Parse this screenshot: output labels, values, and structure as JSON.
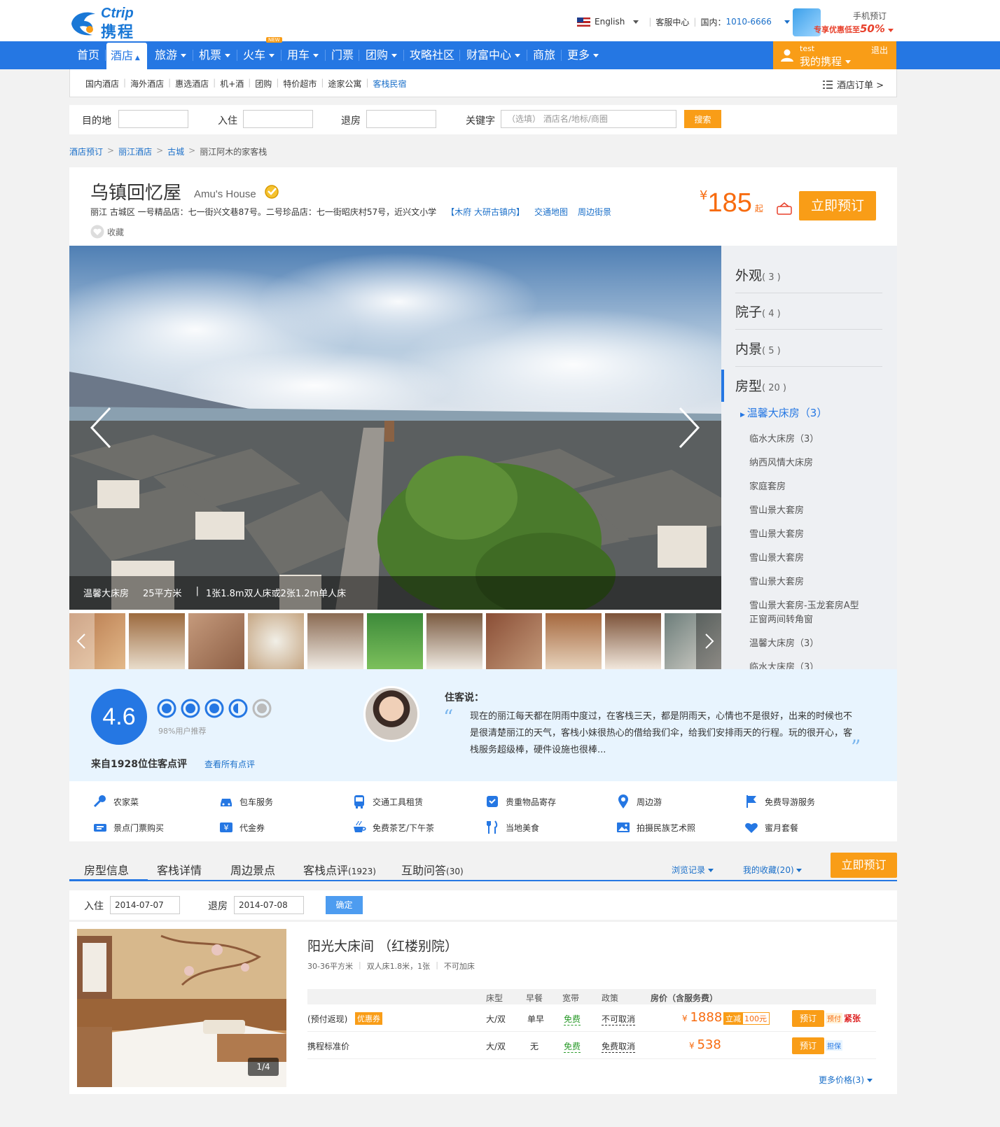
{
  "header": {
    "logo_en": "Ctrip",
    "logo_cn": "携程",
    "language": "English",
    "service": "客服中心",
    "phone_label": "国内：",
    "phone_number": "1010-6666",
    "mobile_title": "手机预订",
    "mobile_promo": "专享优惠低至",
    "mobile_promo_pct": "50%"
  },
  "nav": {
    "items": [
      {
        "label": "首页"
      },
      {
        "label": "酒店"
      },
      {
        "label": "旅游"
      },
      {
        "label": "机票"
      },
      {
        "label": "火车",
        "badge": "NEW"
      },
      {
        "label": "用车"
      },
      {
        "label": "门票"
      },
      {
        "label": "团购"
      },
      {
        "label": "攻略社区"
      },
      {
        "label": "财富中心"
      },
      {
        "label": "商旅"
      },
      {
        "label": "更多"
      }
    ],
    "user_name": "test",
    "user_menu": "我的携程",
    "logout": "退出"
  },
  "subnav": {
    "items": [
      "国内酒店",
      "海外酒店",
      "惠选酒店",
      "机+酒",
      "团购",
      "特价超市",
      "途家公寓",
      "客栈民宿"
    ],
    "orders": "酒店订单 >"
  },
  "search": {
    "destination_label": "目的地",
    "checkin_label": "入住",
    "checkout_label": "退房",
    "keyword_label": "关键字",
    "keyword_placeholder": "（选填） 酒店名/地标/商圈",
    "button": "搜索"
  },
  "breadcrumb": [
    "酒店预订",
    "丽江酒店",
    "古城",
    "丽江阿木的家客栈"
  ],
  "hotel": {
    "name_cn": "乌镇回忆屋",
    "name_en": "Amu's House",
    "address": "丽江 古城区 一号精品店：七一街兴文巷87号。二号珍品店：七一街昭庆村57号，近兴文小学",
    "area_tag": "【木府 大研古镇内】",
    "map_link": "交通地图",
    "street_link": "周边街景",
    "favorite": "收藏",
    "price_symbol": "¥",
    "price": "185",
    "price_suffix": "起",
    "book_button": "立即预订"
  },
  "gallery": {
    "caption_room": "温馨大床房",
    "caption_area": "25平方米",
    "caption_beds": "1张1.8m双人床或2张1.2m单人床",
    "categories": [
      {
        "name": "外观",
        "count": "( 3 )"
      },
      {
        "name": "院子",
        "count": "( 4 )"
      },
      {
        "name": "内景",
        "count": "( 5 )"
      },
      {
        "name": "房型",
        "count": "( 20 )"
      }
    ],
    "room_types": [
      "温馨大床房（3）",
      "临水大床房（3）",
      "纳西风情大床房",
      "家庭套房",
      "雪山景大套房",
      "雪山景大套房",
      "雪山景大套房",
      "雪山景大套房",
      "雪山景大套房-玉龙套房A型",
      "正窗两间转角窗",
      "温馨大床房（3）",
      "临水大床房（3）"
    ]
  },
  "rating": {
    "score": "4.6",
    "recommend": "98%用户推荐",
    "review_count_text": "来自1928位住客点评",
    "all_reviews": "查看所有点评",
    "guest_says": "住客说：",
    "review_text": "现在的丽江每天都在阴雨中度过，在客栈三天，都是阴雨天，心情也不是很好，出来的时候也不是很清楚丽江的天气，客栈小妹很热心的借给我们伞，给我们安排雨天的行程。玩的很开心，客栈服务超级棒，硬件设施也很棒..."
  },
  "amenities": [
    "农家菜",
    "包车服务",
    "交通工具租赁",
    "贵重物品寄存",
    "周边游",
    "免费导游服务",
    "景点门票购买",
    "代金券",
    "免费茶艺/下午茶",
    "当地美食",
    "拍摄民族艺术照",
    "蜜月套餐"
  ],
  "tabs": {
    "items": [
      "房型信息",
      "客栈详情",
      "周边景点",
      "客栈点评",
      "互助问答"
    ],
    "review_count": "(1923)",
    "qa_count": "(30)",
    "history": "浏览记录",
    "favorites": "我的收藏(20)",
    "book": "立即预订"
  },
  "dates": {
    "checkin_label": "入住",
    "checkin": "2014-07-07",
    "checkout_label": "退房",
    "checkout": "2014-07-08",
    "confirm": "确定"
  },
  "room": {
    "title": "阳光大床间 （红楼别院）",
    "specs": [
      "30-36平方米",
      "双人床1.8米，1张",
      "不可加床"
    ],
    "photo_counter": "1/4",
    "headers": [
      "床型",
      "早餐",
      "宽带",
      "政策",
      "房价（含服务费）"
    ],
    "rows": [
      {
        "name": "(预付返现)",
        "tag": "优惠券",
        "bed": "大/双",
        "breakfast": "单早",
        "wifi": "免费",
        "policy": "不可取消",
        "price_symbol": "¥",
        "price": "1888",
        "discount": "立减",
        "discount_amount": "100元",
        "book": "预订",
        "pay_tag": "预付",
        "status": "紧张"
      },
      {
        "name": "携程标准价",
        "tag": "",
        "bed": "大/双",
        "breakfast": "无",
        "wifi": "免费",
        "policy": "免费取消",
        "price_symbol": "¥",
        "price": "538",
        "discount": "",
        "discount_amount": "",
        "book": "预订",
        "pay_tag": "担保",
        "status": ""
      }
    ],
    "more_prices": "更多价格(3)"
  },
  "colors": {
    "primary": "#2577e3",
    "accent": "#f99d17",
    "price": "#f76b0f"
  }
}
